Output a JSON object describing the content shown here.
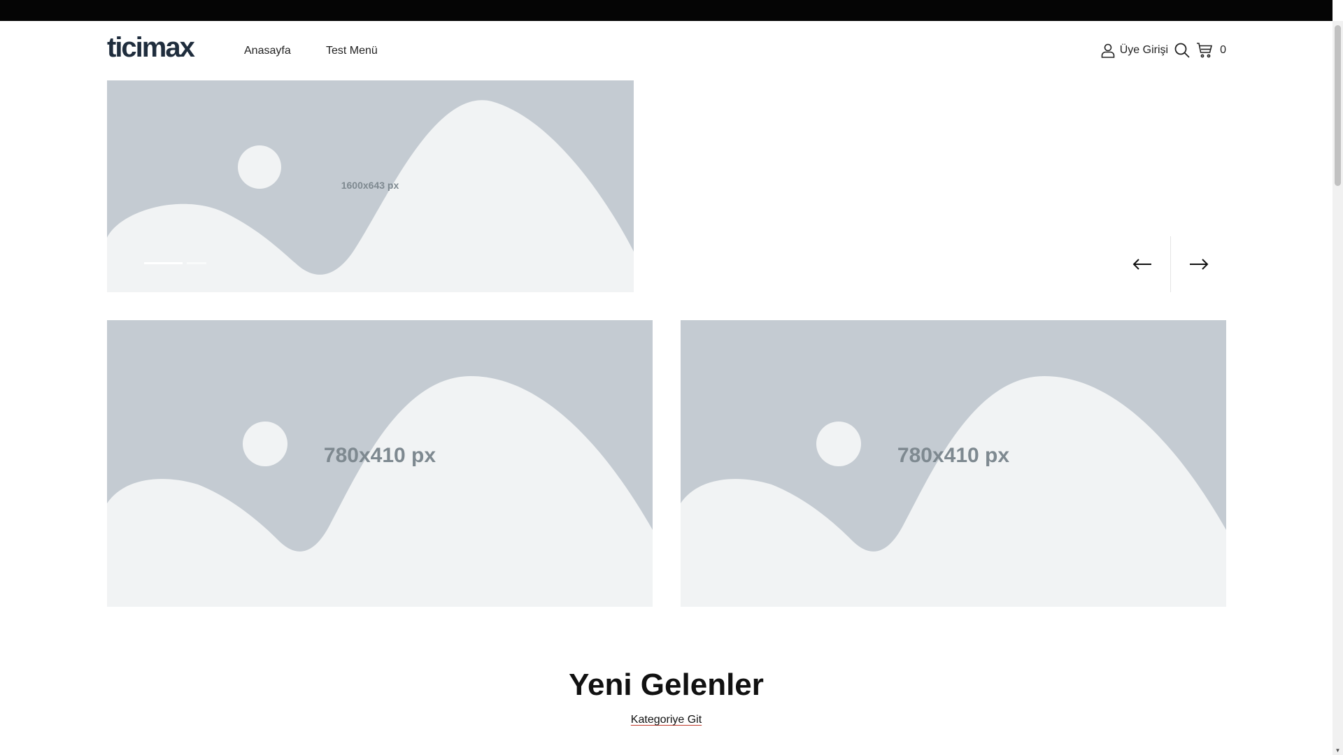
{
  "header": {
    "logo_text": "ticimax",
    "nav": [
      {
        "label": "Anasayfa"
      },
      {
        "label": "Test Menü"
      }
    ],
    "login_label": "Üye Girişi",
    "cart_count": "0",
    "icons": {
      "user": "user-icon",
      "search": "search-icon",
      "cart": "cart-icon"
    }
  },
  "slider": {
    "image_label": "1600x643 px",
    "dots_total": 2,
    "active_dot": 1,
    "prev_icon": "arrow-left-icon",
    "next_icon": "arrow-right-icon"
  },
  "banners": [
    {
      "image_label": "780x410 px"
    },
    {
      "image_label": "780x410 px"
    }
  ],
  "section": {
    "title": "Yeni Gelenler",
    "link_label": "Kategoriye Git"
  },
  "colors": {
    "topbar": "#050505",
    "placeholder_bg": "#c4cbd2",
    "placeholder_fg": "#f1f3f4",
    "placeholder_text": "#7e8990",
    "logo": "#1f2d3d",
    "link_underline": "#c0392b"
  }
}
